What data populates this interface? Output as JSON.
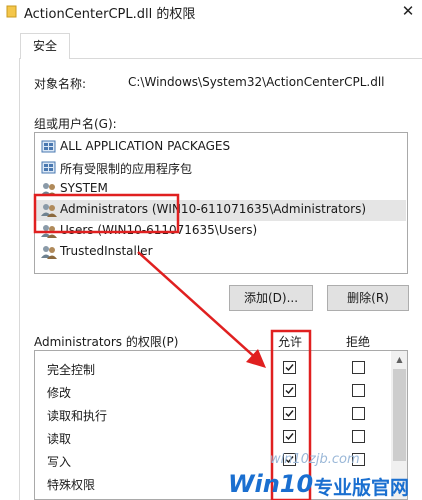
{
  "window": {
    "title": "ActionCenterCPL.dll 的权限",
    "close_glyph": "✕"
  },
  "tabs": [
    {
      "label": "安全",
      "active": true
    }
  ],
  "object": {
    "label": "对象名称:",
    "value": "C:\\Windows\\System32\\ActionCenterCPL.dll"
  },
  "groups": {
    "label": "组或用户名(G):",
    "items": [
      {
        "name": "ALL APPLICATION PACKAGES",
        "icon": "app-package-icon",
        "selected": false
      },
      {
        "name": "所有受限制的应用程序包",
        "icon": "app-package-icon",
        "selected": false
      },
      {
        "name": "SYSTEM",
        "icon": "user-group-icon",
        "selected": false
      },
      {
        "name": "Administrators (WIN10-611071635\\Administrators)",
        "icon": "user-group-icon",
        "selected": true
      },
      {
        "name": "Users (WIN10-611071635\\Users)",
        "icon": "user-group-icon",
        "selected": false
      },
      {
        "name": "TrustedInstaller",
        "icon": "user-group-icon",
        "selected": false
      }
    ],
    "add_label": "添加(D)...",
    "remove_label": "删除(R)"
  },
  "permissions": {
    "title": "Administrators 的权限(P)",
    "allow_header": "允许",
    "deny_header": "拒绝",
    "rows": [
      {
        "name": "完全控制",
        "allow": true,
        "deny": false
      },
      {
        "name": "修改",
        "allow": true,
        "deny": false
      },
      {
        "name": "读取和执行",
        "allow": true,
        "deny": false
      },
      {
        "name": "读取",
        "allow": true,
        "deny": false
      },
      {
        "name": "写入",
        "allow": true,
        "deny": false
      },
      {
        "name": "特殊权限",
        "allow": false,
        "deny": false
      }
    ]
  },
  "annotation": {
    "color": "#e02020"
  },
  "watermark": {
    "site": "win10zjb.com",
    "brand_latin": "Win10",
    "brand_cn": "专业版官网"
  }
}
